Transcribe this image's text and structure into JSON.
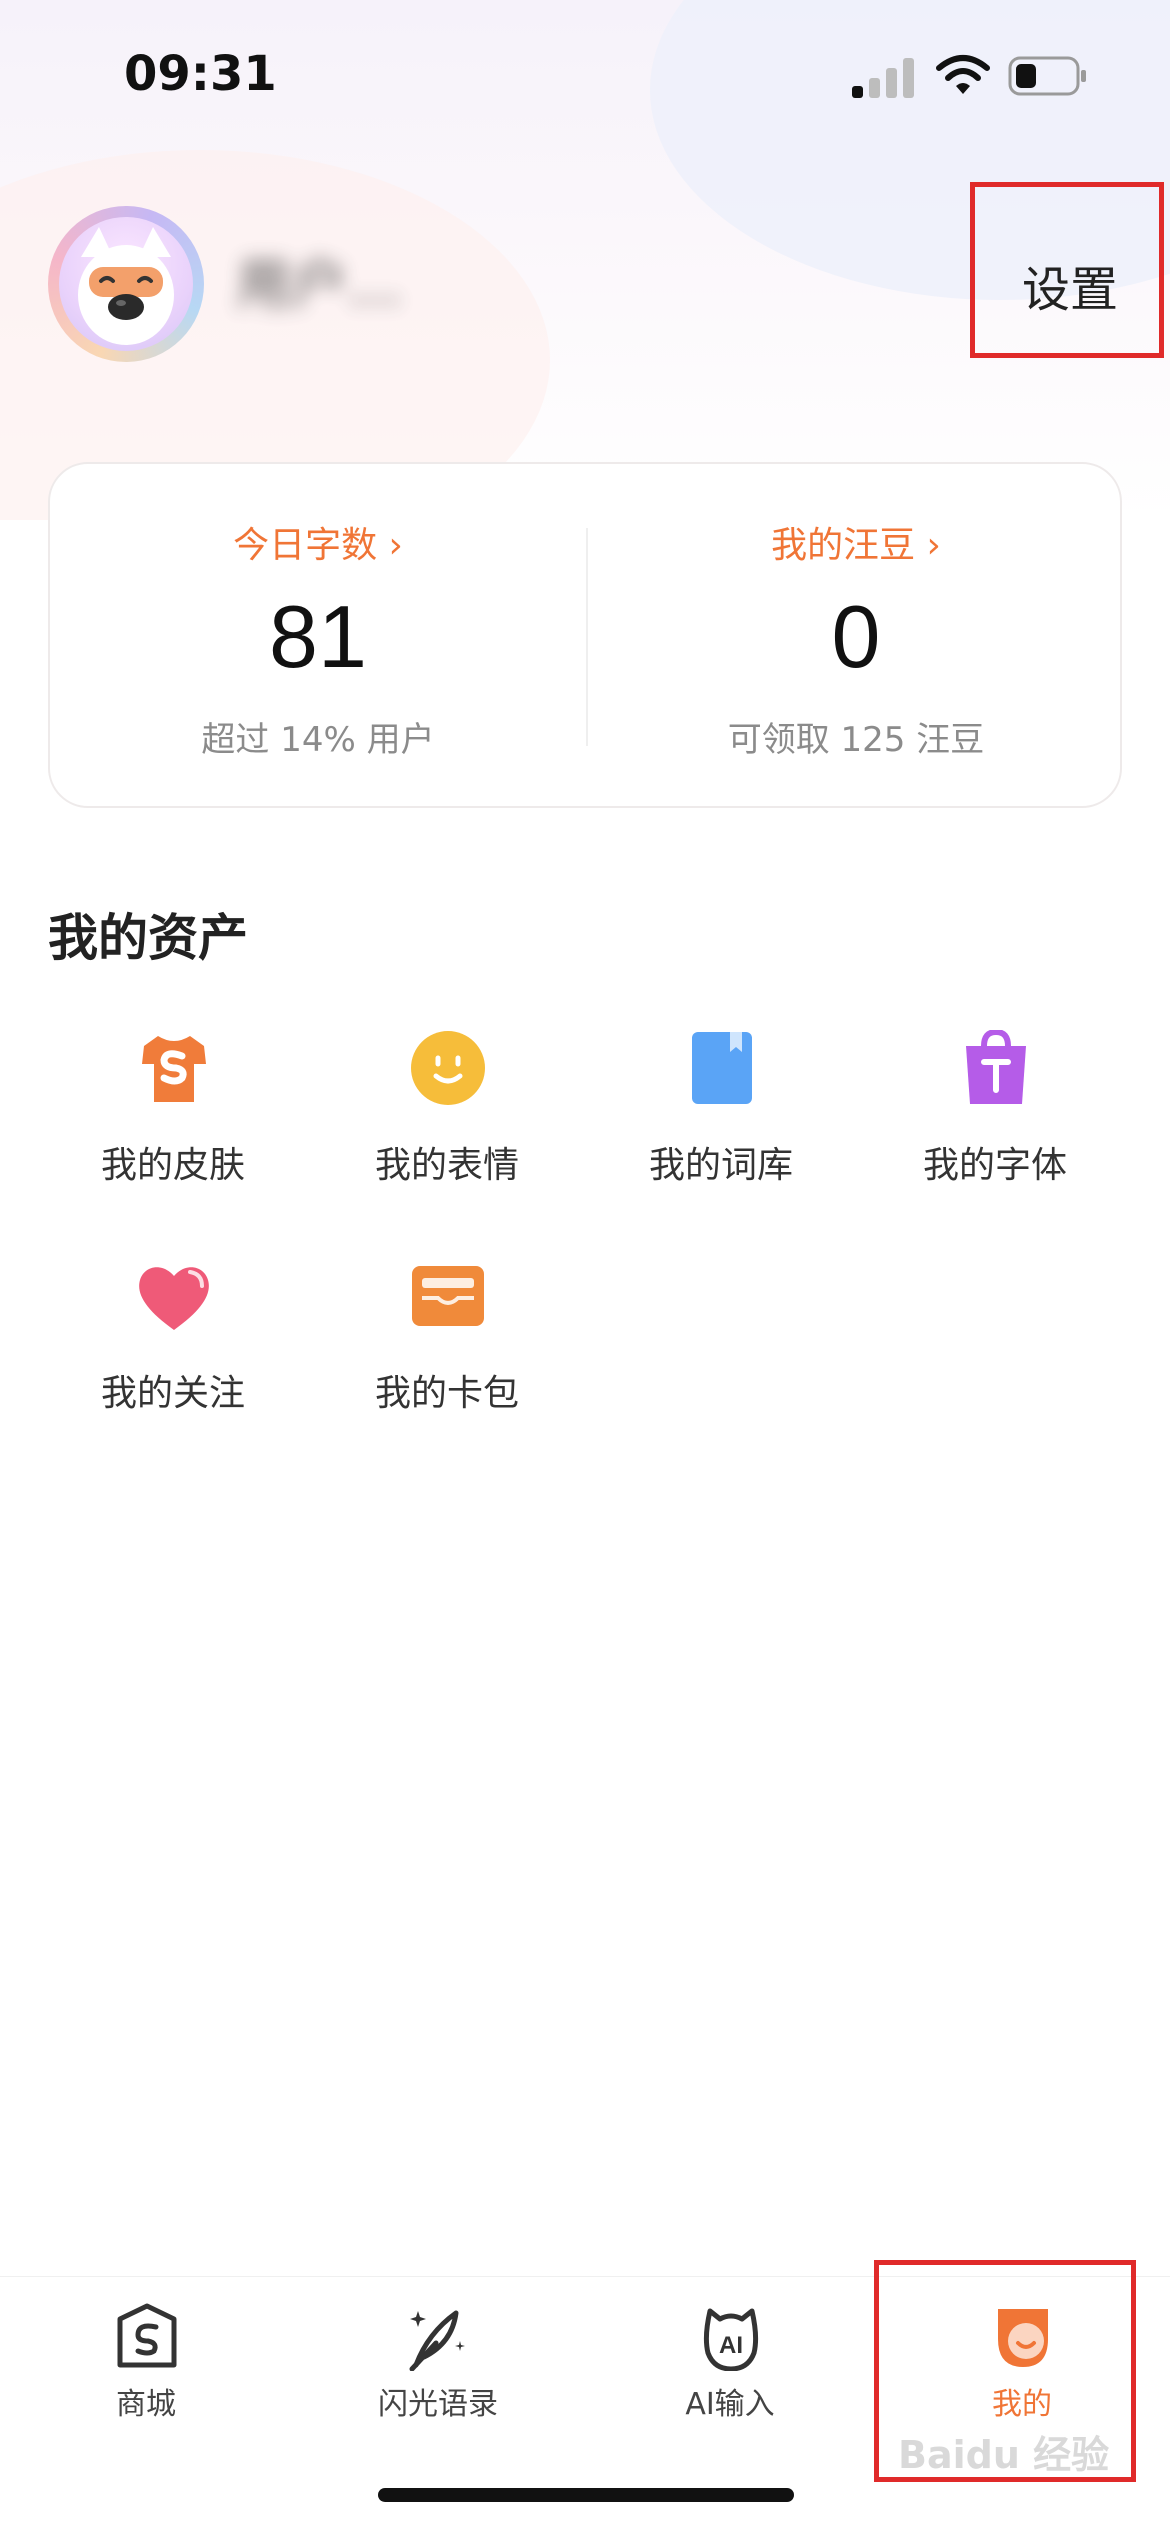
{
  "status_bar": {
    "time": "09:31"
  },
  "profile": {
    "username": "用户...",
    "settings_label": "设置"
  },
  "stats": [
    {
      "label": "今日字数 ›",
      "value": "81",
      "sub": "超过 14% 用户"
    },
    {
      "label": "我的汪豆 ›",
      "value": "0",
      "sub": "可领取 125 汪豆"
    }
  ],
  "assets": {
    "title": "我的资产",
    "items": [
      {
        "label": "我的皮肤",
        "icon": "tshirt-icon"
      },
      {
        "label": "我的表情",
        "icon": "smiley-icon"
      },
      {
        "label": "我的词库",
        "icon": "book-icon"
      },
      {
        "label": "我的字体",
        "icon": "font-bag-icon"
      },
      {
        "label": "我的关注",
        "icon": "heart-icon"
      },
      {
        "label": "我的卡包",
        "icon": "card-wallet-icon"
      }
    ]
  },
  "tabbar": {
    "items": [
      {
        "label": "商城",
        "icon": "store-icon"
      },
      {
        "label": "闪光语录",
        "icon": "feather-sparkle-icon"
      },
      {
        "label": "AI输入",
        "icon": "ai-input-icon"
      },
      {
        "label": "我的",
        "icon": "mine-icon",
        "active": true
      }
    ]
  },
  "watermark": "Baidu 经验",
  "colors": {
    "accent": "#f07536",
    "highlight_box": "#e02a2a"
  }
}
